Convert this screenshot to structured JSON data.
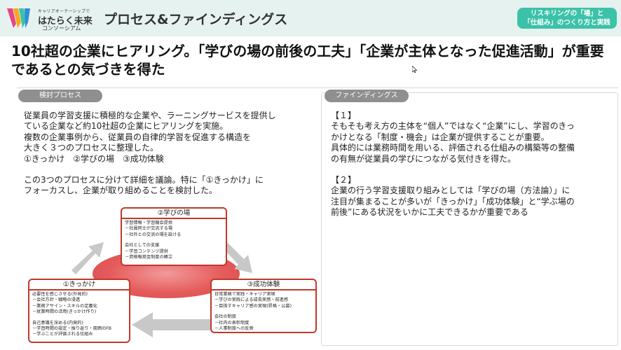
{
  "header": {
    "logo_small": "キャリアオーナーシップで",
    "logo_main": "はたらく未来",
    "logo_sub": "コンソーシアム",
    "title": "プロセス&ファインディングス",
    "badge_lines": [
      "リスキリングの「場」と",
      "「仕組み」のつくり方と実践"
    ]
  },
  "main_title": "10社超の企業にヒアリング。「学びの場の前後の工夫」「企業が主体となった促進活動」が重要であるとの気づきを得た",
  "left_panel": {
    "label": "検討プロセス",
    "lines": [
      "従業員の学習支援に積極的な企業や、ラーニングサービスを提供し",
      "ている企業など約10社超の企業にヒアリングを実施。",
      "複数の企業事例から、従業員の自律的学習を促進する構造を",
      "大きく３つのプロセスに整理した。",
      "①きっかけ　②学びの場　③成功体験",
      "",
      "この3つのプロセスに分けて詳細を議論。特に「①きっかけ」に",
      "フォーカスし、企業が取り組めることを検討した。"
    ]
  },
  "right_panel": {
    "label": "ファインディングス",
    "lines": [
      "【１】",
      "そもそも考え方の主体を“個人”ではなく“企業”にし、学習のきっ",
      "かけとなる「制度・機会」は企業が提供することが重要。",
      "具体的には業務時間を用いる、評価される仕組みの構築等の整備",
      "の有無が従業員の学びにつながる気付きを得た。",
      "",
      "【２】",
      "企業の行う学習支援取り組みとしては「学びの場（方法論）」に",
      "注目が集まることが多いが「きっかけ」「成功体験」と“学ぶ場の",
      "前後”にある状況をいかに工夫できるかが重要である"
    ]
  },
  "diagram": {
    "learning": {
      "title": "②学びの場",
      "lines": [
        "学習情報・学習機会提供",
        "－社員同士が交流する場",
        "－社外との交流の場を設ける",
        "",
        "会社としての支援",
        "－学習コンテンツ提供",
        "－資格報奨金制度の確立"
      ]
    },
    "trigger": {
      "title": "①きっかけ",
      "lines": [
        "必要性を感じさせる(外発的)",
        "－会社方針・戦略の浸透",
        "－業務アサイン・スキルの定義化",
        "－就業時間の活用(きっかけ作り)",
        "",
        "自己意識を深める(内発的)",
        "－学習時間の設定・振り返り・周囲のFB",
        "－学ぶことが評価される仕組み"
      ]
    },
    "success": {
      "title": "③成功体験",
      "lines": [
        "日常業務で実践・キャリア実現",
        "－学びの実践による成長実感・前進感",
        "－目指すキャリア感の実現(昇格・公募)",
        "",
        "会社の制度",
        "－社内の表彰制度",
        "－人事制度への反映"
      ]
    },
    "colors": {
      "box_border": "#c0392b",
      "arrow": "#c8c8c8",
      "ellipse": "#e55b5b"
    }
  },
  "colors": {
    "header_bg": "#e6f2ef",
    "badge": "#3cc2a8",
    "pill": "#8f8f8f"
  }
}
